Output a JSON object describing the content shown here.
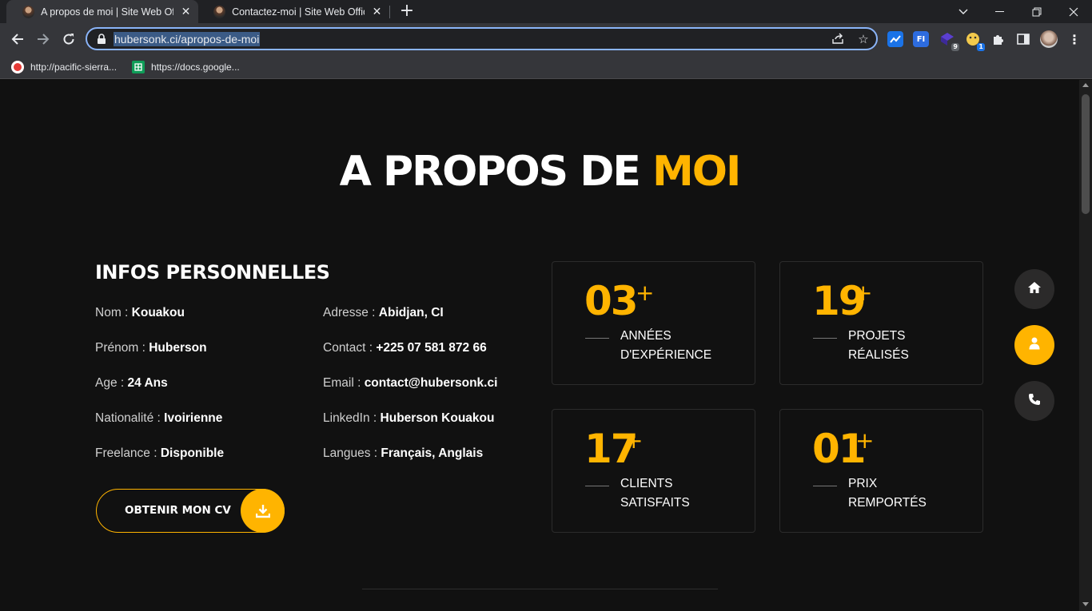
{
  "browser": {
    "tabs": [
      {
        "title": "A propos de moi | Site Web Offic",
        "active": true
      },
      {
        "title": "Contactez-moi | Site Web Officiel",
        "active": false
      }
    ],
    "new_tab": "+",
    "url": "hubersonk.ci/apropos-de-moi",
    "bookmarks": [
      {
        "label": "http://pacific-sierra...",
        "icon": "red-favicon"
      },
      {
        "label": "https://docs.google...",
        "icon": "green-sheets-icon"
      }
    ],
    "extension_badges": {
      "ext3": "9",
      "ext4": "1"
    }
  },
  "page": {
    "title_main": "A PROPOS DE",
    "title_highlight": "MOI",
    "infos_title": "INFOS PERSONNELLES",
    "infos": [
      {
        "label": "Nom :",
        "value": "Kouakou"
      },
      {
        "label": "Prénom :",
        "value": "Huberson"
      },
      {
        "label": "Age :",
        "value": "24 Ans"
      },
      {
        "label": "Nationalité :",
        "value": "Ivoirienne"
      },
      {
        "label": "Freelance :",
        "value": "Disponible"
      },
      {
        "label": "Adresse :",
        "value": "Abidjan, CI"
      },
      {
        "label": "Contact :",
        "value": "+225 07 581 872 66"
      },
      {
        "label": "Email :",
        "value": "contact@hubersonk.ci"
      },
      {
        "label": "LinkedIn :",
        "value": "Huberson Kouakou"
      },
      {
        "label": "Langues :",
        "value": "Français, Anglais"
      }
    ],
    "cv_button": "OBTENIR MON CV",
    "stats": [
      {
        "number": "03",
        "plus": "+",
        "line1": "ANNÉES",
        "line2": "D'EXPÉRIENCE"
      },
      {
        "number": "19",
        "plus": "+",
        "line1": "PROJETS",
        "line2": "RÉALISÉS"
      },
      {
        "number": "17",
        "plus": "+",
        "line1": "CLIENTS",
        "line2": "SATISFAITS"
      },
      {
        "number": "01",
        "plus": "+",
        "line1": "PRIX",
        "line2": "REMPORTÉS"
      }
    ],
    "side_nav": [
      {
        "icon": "home-icon",
        "active": false
      },
      {
        "icon": "user-icon",
        "active": true
      },
      {
        "icon": "phone-icon",
        "active": false
      }
    ]
  },
  "colors": {
    "accent": "#ffb400",
    "background": "#111111",
    "card_border": "#2c2c2c"
  }
}
